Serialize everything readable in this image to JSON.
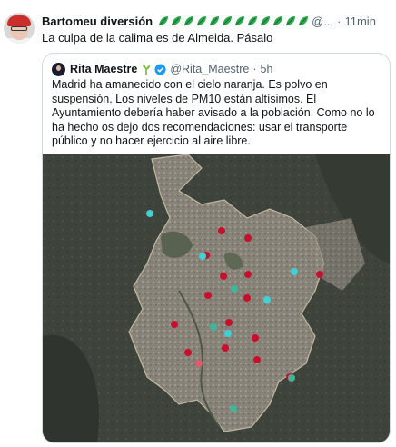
{
  "tweet": {
    "author_name": "Bartomeu diversión",
    "name_emoji_icon": "leaf-emoji-icon",
    "handle": "@...",
    "separator": "·",
    "time": "11min",
    "text": "La culpa de la calima es de Almeida. Pásalo"
  },
  "quoted_tweet": {
    "author_name": "Rita Maestre",
    "handle": "@Rita_Maestre",
    "separator": "·",
    "time": "5h",
    "text": "Madrid ha amanecido con el cielo naranja. Es polvo en suspensión. Los niveles de PM10 están altísimos. El Ayuntamiento debería haber avisado a la población. Como no lo ha hecho os dejo dos recomendaciones: usar el transporte público y no hacer ejercicio al aire libre.",
    "icons": {
      "plant": "plant-emoji-icon",
      "verified": "verified-badge-icon"
    }
  },
  "colors": {
    "text": "#0f1419",
    "secondary": "#536471",
    "border": "#cfd9de",
    "leaf_green": "#1f9d55",
    "verified_blue": "#1d9bf0",
    "station_red": "#c8102e",
    "station_cyan": "#3fd0d8",
    "station_teal": "#3fb59a",
    "station_pink": "#e05a6e"
  },
  "map": {
    "description_type": "satellite-map-air-quality-stations",
    "stations": [
      {
        "color": "cyan"
      },
      {
        "color": "red"
      },
      {
        "color": "red"
      },
      {
        "color": "red"
      },
      {
        "color": "cyan"
      },
      {
        "color": "cyan"
      },
      {
        "color": "red"
      },
      {
        "color": "red"
      },
      {
        "color": "red"
      },
      {
        "color": "red"
      },
      {
        "color": "teal"
      },
      {
        "color": "red"
      },
      {
        "color": "cyan"
      },
      {
        "color": "red"
      },
      {
        "color": "teal"
      },
      {
        "color": "red"
      },
      {
        "color": "cyan"
      },
      {
        "color": "red"
      },
      {
        "color": "red"
      },
      {
        "color": "red"
      },
      {
        "color": "red"
      },
      {
        "color": "pink"
      },
      {
        "color": "red"
      },
      {
        "color": "teal"
      },
      {
        "color": "teal"
      }
    ]
  }
}
